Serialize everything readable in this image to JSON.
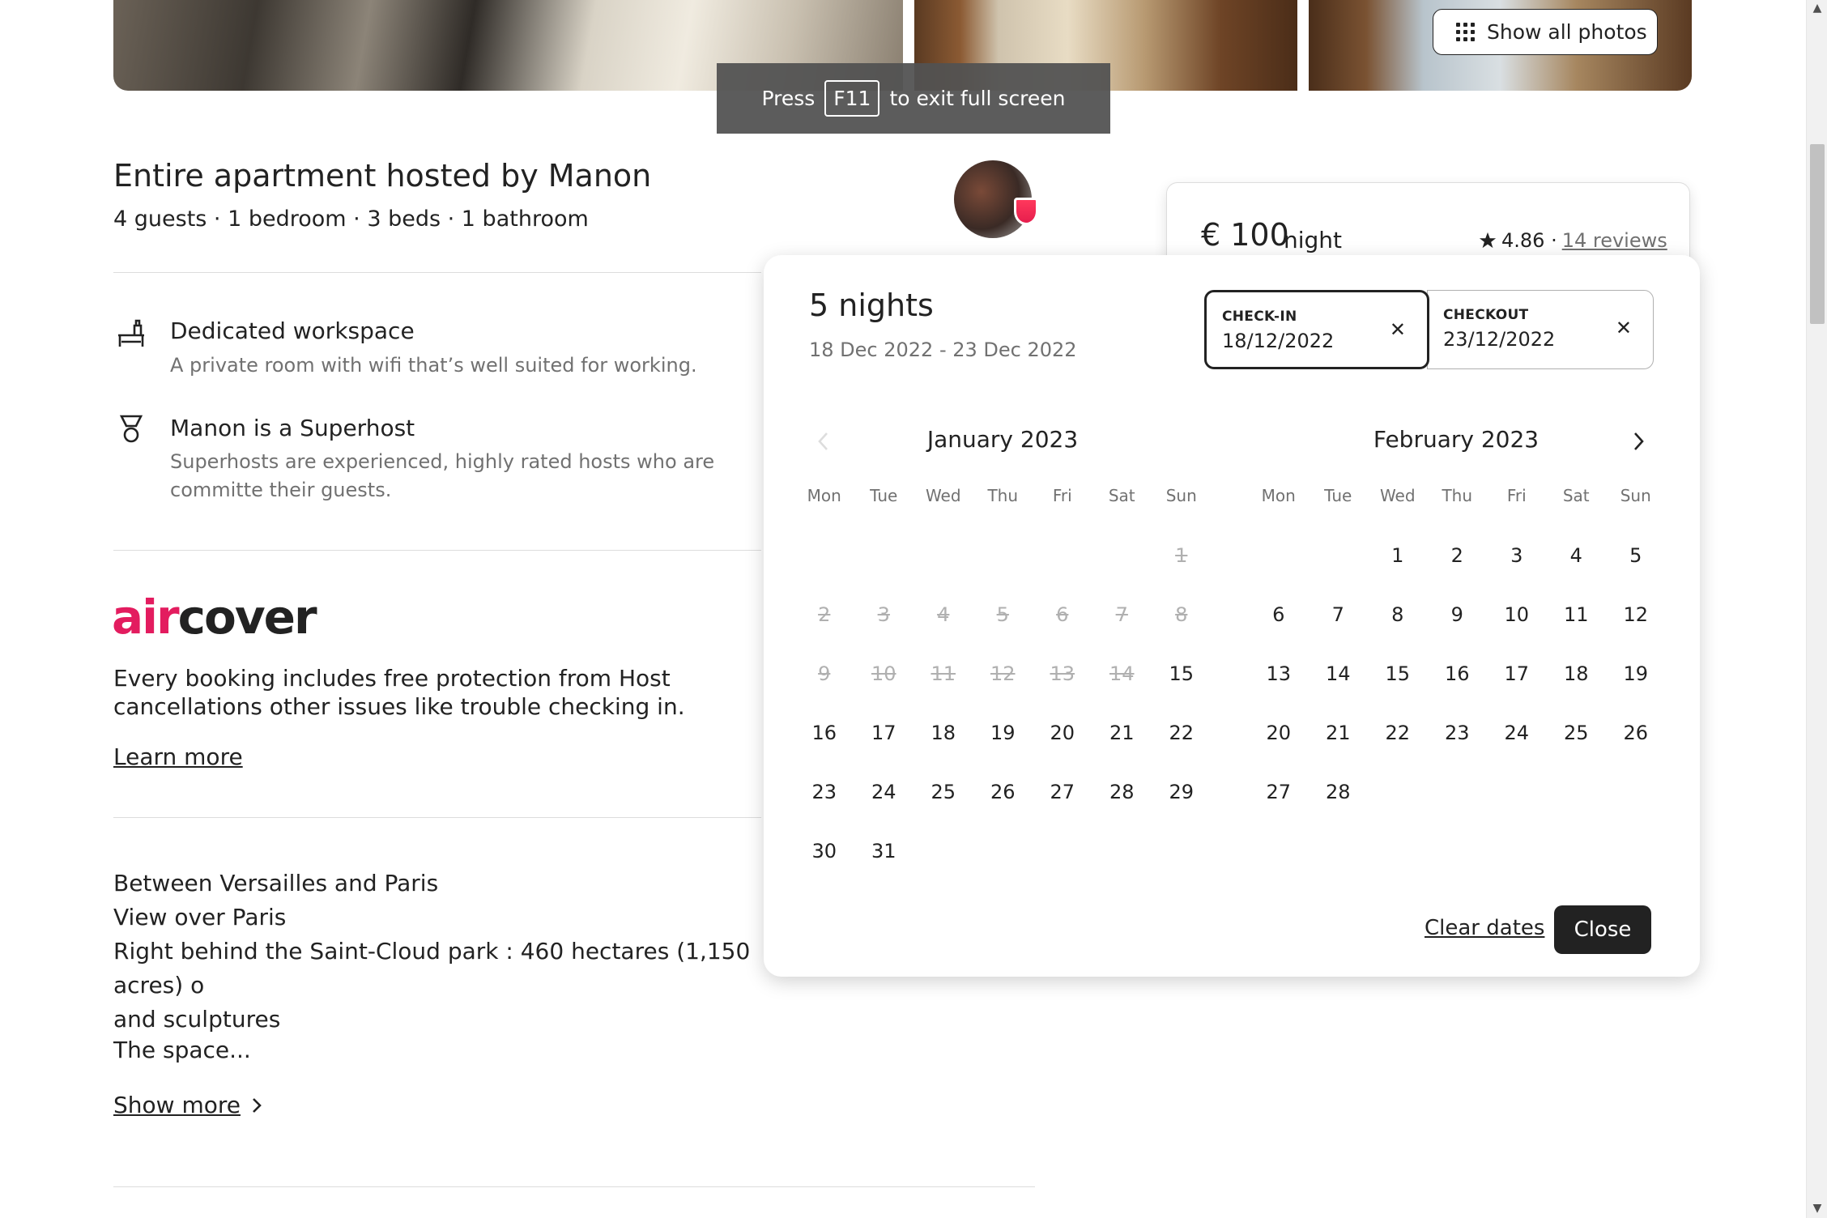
{
  "photos": {
    "show_all_label": "Show all photos"
  },
  "fullscreen_toast": {
    "press": "Press",
    "key": "F11",
    "suffix": "to exit full screen"
  },
  "listing": {
    "title": "Entire apartment hosted by Manon",
    "subtitle": "4 guests · 1 bedroom · 3 beds · 1 bathroom"
  },
  "features": [
    {
      "title": "Dedicated workspace",
      "desc": "A private room with wifi that’s well suited for working.",
      "icon": "desk-icon"
    },
    {
      "title": "Manon is a Superhost",
      "desc": "Superhosts are experienced, highly rated hosts who are committe their guests.",
      "icon": "superhost-medal-icon"
    }
  ],
  "aircover": {
    "logo_air": "air",
    "logo_cover": "cover",
    "text": "Every booking includes free protection from Host cancellations other issues like trouble checking in.",
    "learn_more": "Learn more"
  },
  "description": {
    "lines": [
      "Between Versailles and Paris",
      "View over Paris",
      "Right behind the Saint-Cloud park : 460 hectares (1,150 acres) o",
      "and sculptures"
    ],
    "space_title": "The space...",
    "show_more": "Show more"
  },
  "booking": {
    "price": "€ 100",
    "price_unit": "night",
    "rating": "4.86 ·",
    "reviews": "14 reviews"
  },
  "date_picker": {
    "nights": "5 nights",
    "range": "18 Dec 2022 - 23 Dec 2022",
    "checkin_label": "CHECK-IN",
    "checkin_value": "18/12/2022",
    "checkout_label": "CHECKOUT",
    "checkout_value": "23/12/2022",
    "weekdays": [
      "Mon",
      "Tue",
      "Wed",
      "Thu",
      "Fri",
      "Sat",
      "Sun"
    ],
    "months": [
      {
        "title": "January 2023",
        "offset": 6,
        "days": 31,
        "past_through": 14
      },
      {
        "title": "February 2023",
        "offset": 2,
        "days": 28,
        "past_through": 0
      }
    ],
    "clear_dates": "Clear dates",
    "close": "Close"
  },
  "colors": {
    "brand": "#e31c5f",
    "text": "#222222",
    "muted": "#717171",
    "disabled": "#b0b0b0"
  }
}
